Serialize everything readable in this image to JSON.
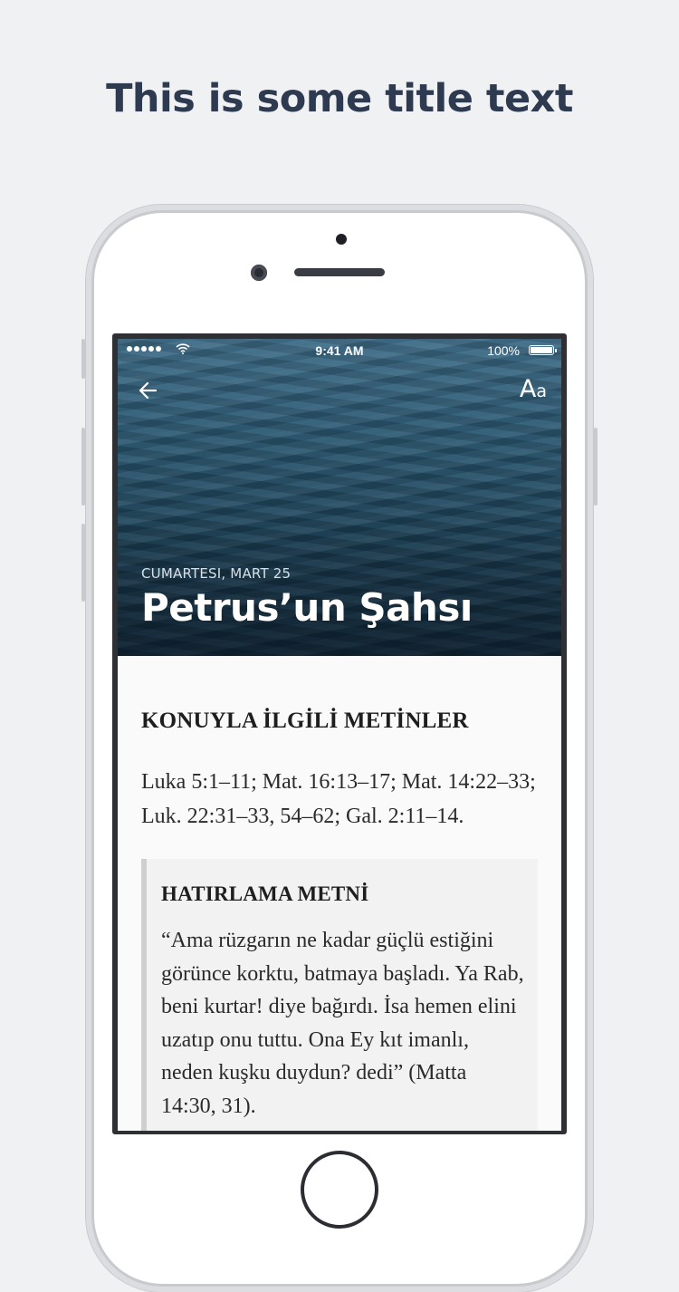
{
  "promo": {
    "title": "This is some title text"
  },
  "status_bar": {
    "time": "9:41 AM",
    "battery": "100%"
  },
  "header": {
    "back_icon": "arrow-left-icon",
    "font_button_big": "A",
    "font_button_small": "a",
    "date": "CUMARTESI, MART 25",
    "title": "Petrus’un Şahsı"
  },
  "content": {
    "section_heading": "KONUYLA İLGİLİ METİNLER",
    "readings": "Luka 5:1–11; Mat. 16:13–17; Mat. 14:22–33; Luk. 22:31–33, 54–62; Gal. 2:11–14.",
    "memory": {
      "heading": "HATIRLAMA METNİ",
      "text": "“Ama rüzgarın ne kadar güçlü estiğini görünce korktu, batmaya başladı. Ya Rab, beni kurtar! diye bağırdı. İsa hemen elini uzatıp onu tuttu. Ona Ey kıt imanlı, neden kuşku duydun? dedi” (Matta 14:30, 31)."
    }
  },
  "colors": {
    "background": "#f0f1f3",
    "title": "#2e3a50",
    "hero": "#1d4257"
  }
}
